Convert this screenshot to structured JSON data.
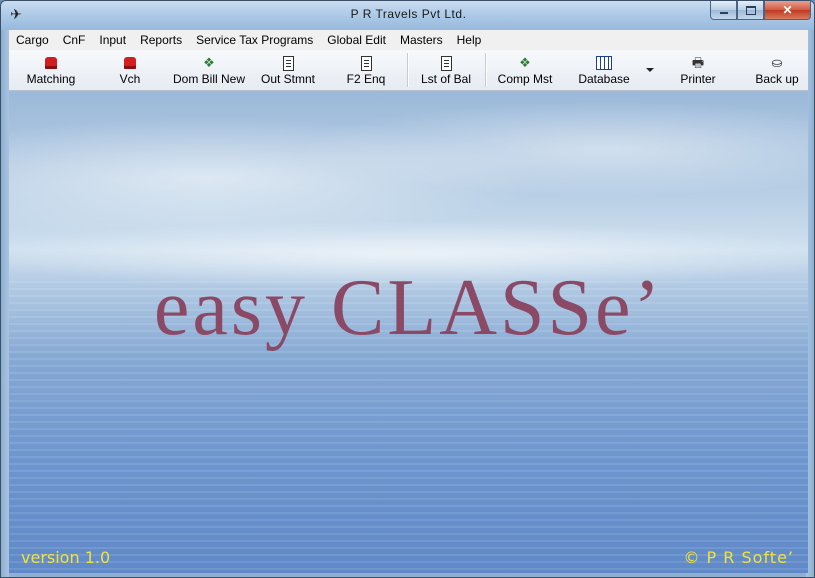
{
  "window": {
    "title": "P R  Travels  Pvt Ltd.",
    "app_icon": "airplane-icon"
  },
  "menu": [
    "Cargo",
    "CnF",
    "Input",
    "Reports",
    "Service Tax Programs",
    "Global Edit",
    "Masters",
    "Help"
  ],
  "toolbar": {
    "buttons": [
      {
        "label": "Matching",
        "icon": "stamp-icon"
      },
      {
        "label": "Vch",
        "icon": "stamp-icon"
      },
      {
        "label": "Dom Bill New",
        "icon": "money-icon"
      },
      {
        "label": "Out Stmnt",
        "icon": "document-icon"
      },
      {
        "label": "F2 Enq",
        "icon": "document-icon"
      },
      {
        "label": "Lst of Bal",
        "icon": "document-icon"
      },
      {
        "label": "Comp Mst",
        "icon": "money-icon"
      },
      {
        "label": "Database",
        "icon": "grid-icon"
      },
      {
        "label": "Printer",
        "icon": "printer-icon"
      },
      {
        "label": "Back up",
        "icon": "disk-icon"
      }
    ]
  },
  "main": {
    "brand": "easy CLASSe’",
    "version": "version 1.0",
    "copyright": "© P R  Softe’"
  },
  "colors": {
    "brand_text": "#8a4a66",
    "footer_text": "#f2e23a"
  }
}
